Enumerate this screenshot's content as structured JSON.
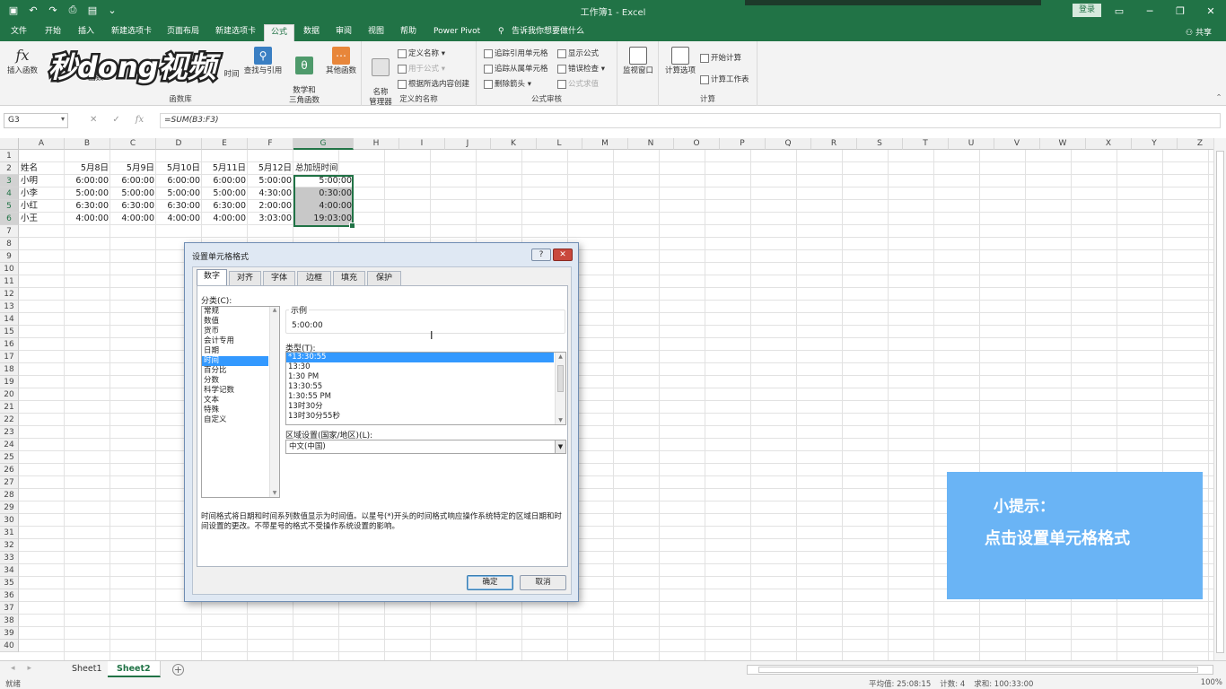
{
  "window": {
    "title": "工作簿1 - Excel",
    "login_label": "登录",
    "share_label": "共享"
  },
  "colors": {
    "accent": "#217346",
    "selection": "#3399ff",
    "tip_bg": "#6ab4f5"
  },
  "ribbon_tabs": [
    "文件",
    "开始",
    "插入",
    "新建选项卡",
    "页面布局",
    "新建选项卡",
    "公式",
    "数据",
    "审阅",
    "视图",
    "帮助",
    "Power Pivot",
    "告诉我你想要做什么"
  ],
  "ribbon": {
    "insert_function": "插入函数",
    "functions_label": "函数",
    "time_label": "时间",
    "lookup_label": "查找与引用",
    "math_label": "数学和\n三角函数",
    "more_functions": "其他函数",
    "group_function_library": "函数库",
    "name_manager": "名称\n管理器",
    "define_name": "定义名称",
    "use_in_formula": "用于公式",
    "create_from_selection": "根据所选内容创建",
    "group_defined_names": "定义的名称",
    "trace_precedents": "追踪引用单元格",
    "trace_dependents": "追踪从属单元格",
    "remove_arrows": "删除箭头",
    "show_formulas": "显示公式",
    "error_checking": "错误检查",
    "evaluate_formula": "公式求值",
    "watch_window": "监视窗口",
    "group_formula_auditing": "公式审核",
    "calc_options": "计算选项",
    "calc_now": "开始计算",
    "calc_sheet": "计算工作表",
    "group_calculation": "计算"
  },
  "watermark": "秒dong视频",
  "formula_bar": {
    "name_box": "G3",
    "formula": "=SUM(B3:F3)"
  },
  "columns": [
    "A",
    "B",
    "C",
    "D",
    "E",
    "F",
    "G",
    "H",
    "I",
    "J",
    "K",
    "L",
    "M",
    "N",
    "O",
    "P",
    "Q",
    "R",
    "S",
    "T",
    "U",
    "V",
    "W",
    "X",
    "Y",
    "Z"
  ],
  "rows": [
    "1",
    "2",
    "3",
    "4",
    "5",
    "6",
    "7",
    "8",
    "9",
    "10",
    "11",
    "12",
    "13",
    "14",
    "15",
    "16",
    "17",
    "18",
    "19",
    "20",
    "21",
    "22",
    "23",
    "24",
    "25",
    "26",
    "27",
    "28",
    "29",
    "30",
    "31",
    "32",
    "33",
    "34",
    "35",
    "36",
    "37",
    "38",
    "39",
    "40"
  ],
  "sheet": {
    "headers": [
      "姓名",
      "5月8日",
      "5月9日",
      "5月10日",
      "5月11日",
      "5月12日",
      "总加班时间"
    ],
    "data": [
      [
        "小明",
        "6:00:00",
        "6:00:00",
        "6:00:00",
        "6:00:00",
        "5:00:00",
        "5:00:00"
      ],
      [
        "小李",
        "5:00:00",
        "5:00:00",
        "5:00:00",
        "5:00:00",
        "4:30:00",
        "0:30:00"
      ],
      [
        "小红",
        "6:30:00",
        "6:30:00",
        "6:30:00",
        "6:30:00",
        "2:00:00",
        "4:00:00"
      ],
      [
        "小王",
        "4:00:00",
        "4:00:00",
        "4:00:00",
        "4:00:00",
        "3:03:00",
        "19:03:00"
      ]
    ]
  },
  "sheet_tabs": [
    "Sheet1",
    "Sheet2"
  ],
  "status": {
    "ready": "就绪",
    "average": "平均值: 25:08:15",
    "count": "计数: 4",
    "sum": "求和: 100:33:00",
    "zoom": "100%"
  },
  "dialog": {
    "title": "设置单元格格式",
    "help_label": "?",
    "close_label": "✕",
    "tabs": [
      "数字",
      "对齐",
      "字体",
      "边框",
      "填充",
      "保护"
    ],
    "category_label": "分类(C):",
    "categories": [
      "常规",
      "数值",
      "货币",
      "会计专用",
      "日期",
      "时间",
      "百分比",
      "分数",
      "科学记数",
      "文本",
      "特殊",
      "自定义"
    ],
    "sample_label": "示例",
    "sample_value": "5:00:00",
    "type_label": "类型(T):",
    "types": [
      "*13:30:55",
      "13:30",
      "1:30 PM",
      "13:30:55",
      "1:30:55 PM",
      "13时30分",
      "13时30分55秒"
    ],
    "locale_label": "区域设置(国家/地区)(L):",
    "locale_value": "中文(中国)",
    "description": "时间格式将日期和时间系列数值显示为时间值。以星号(*)开头的时间格式响应操作系统特定的区域日期和时间设置的更改。不带星号的格式不受操作系统设置的影响。",
    "ok_label": "确定",
    "cancel_label": "取消"
  },
  "tip": {
    "title": "小提示：",
    "text": "点击设置单元格格式"
  }
}
